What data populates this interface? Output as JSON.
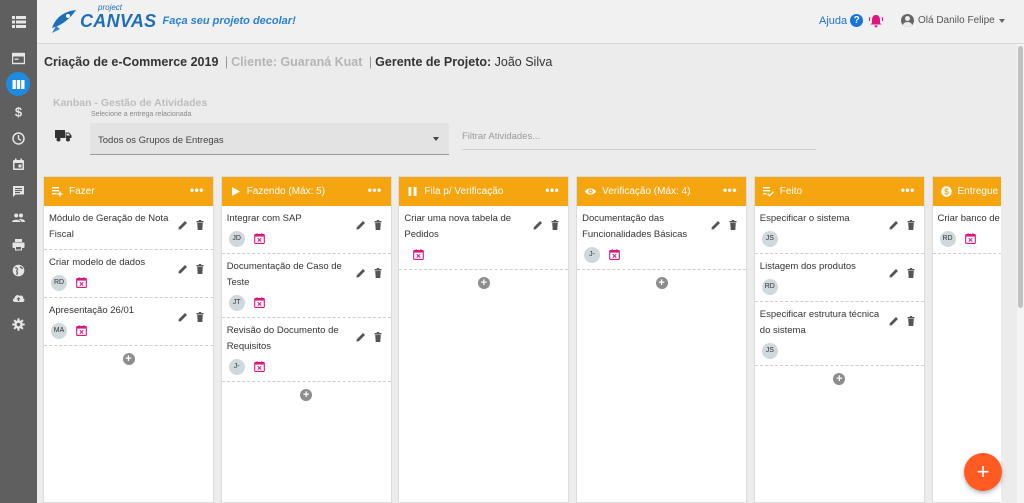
{
  "app": {
    "logo_small": "project",
    "logo_big": "CANVAS",
    "tagline": "Faça seu projeto decolar!",
    "help_label": "Ajuda",
    "help_symbol": "?",
    "user_label": "Olá Danilo Felipe"
  },
  "sidebar": {
    "items": [
      {
        "icon": "dashboard-icon"
      },
      {
        "icon": "kanban-icon",
        "active": true
      },
      {
        "icon": "dollar-icon"
      },
      {
        "icon": "clock-icon"
      },
      {
        "icon": "calendar-icon"
      },
      {
        "icon": "chat-icon"
      },
      {
        "icon": "people-icon"
      },
      {
        "icon": "print-icon"
      },
      {
        "icon": "globe-icon"
      },
      {
        "icon": "cloud-upload-icon"
      },
      {
        "icon": "settings-icon"
      }
    ]
  },
  "project": {
    "name": "Criação de e-Commerce 2019",
    "sep1": "|",
    "client": "Cliente: Guaraná Kuat",
    "sep2": "|",
    "manager_label": "Gerente de Projeto:",
    "manager_name": "João Silva"
  },
  "kanban": {
    "title": "Kanban - Gestão de Atividades",
    "select_label": "Selecione a entrega relacionada",
    "select_value": "Todos os Grupos de Entregas",
    "filter_placeholder": "Filtrar Atividades..."
  },
  "columns": [
    {
      "title": "Fazer",
      "icon": "playlist-add-icon",
      "cards": [
        {
          "text": "Módulo de Geração de Nota Fiscal",
          "avatar": "",
          "calendar": false
        },
        {
          "text": "Criar modelo de dados",
          "avatar": "RD",
          "calendar": true
        },
        {
          "text": "Apresentação 26/01",
          "avatar": "MA",
          "calendar": true
        }
      ]
    },
    {
      "title": "Fazendo (Máx: 5)",
      "icon": "play-icon",
      "cards": [
        {
          "text": "Integrar com SAP",
          "avatar": "JD",
          "calendar": true
        },
        {
          "text": "Documentação de Caso de Teste",
          "avatar": "JT",
          "calendar": true
        },
        {
          "text": "Revisão do Documento de Requisitos",
          "avatar": "J-",
          "calendar": true
        }
      ]
    },
    {
      "title": "Fila p/ Verificação",
      "icon": "pause-icon",
      "cards": [
        {
          "text": "Criar uma nova tabela de Pedidos",
          "avatar": "",
          "calendar": true
        }
      ]
    },
    {
      "title": "Verificação (Máx: 4)",
      "icon": "eye-icon",
      "cards": [
        {
          "text": "Documentação das Funcionalidades Básicas",
          "avatar": "J-",
          "calendar": true
        }
      ]
    },
    {
      "title": "Feito",
      "icon": "checklist-icon",
      "cards": [
        {
          "text": "Especificar o sistema",
          "avatar": "JS",
          "calendar": false
        },
        {
          "text": "Listagem dos produtos",
          "avatar": "RD",
          "calendar": false
        },
        {
          "text": "Especificar estrutura técnica do sistema",
          "avatar": "JS",
          "calendar": false
        }
      ]
    },
    {
      "title": "Entregue p",
      "icon": "dollar-circle-icon",
      "add_button": false,
      "cards": [
        {
          "text": "Criar banco de d",
          "avatar": "RD",
          "calendar": true
        }
      ]
    }
  ],
  "fab_label": "+",
  "colors": {
    "column_header": "#f5a50f",
    "accent_blue": "#1d8ce0",
    "calendar_pink": "#e0167a",
    "fab": "#ff5b22",
    "sidebar": "#5f5f5f"
  }
}
